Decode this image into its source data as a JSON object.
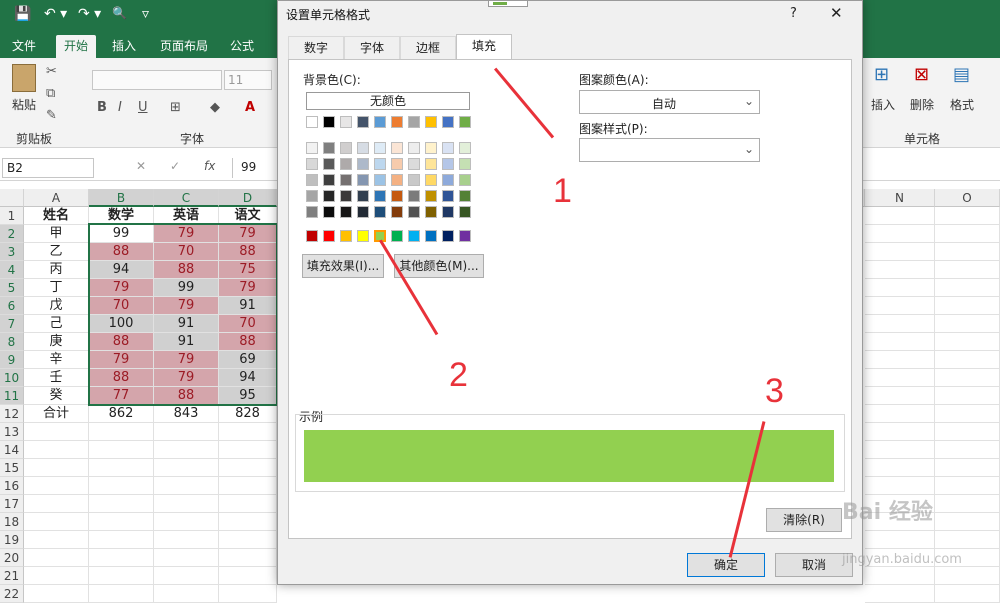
{
  "quick_access": {
    "save_icon": "💾",
    "undo": "↶ ▾",
    "redo": "↷ ▾",
    "preview": "🔍",
    "more": "▿"
  },
  "ribbon_tabs": [
    "文件",
    "开始",
    "插入",
    "页面布局",
    "公式"
  ],
  "ribbon": {
    "paste_label": "粘贴",
    "clipboard_label": "剪贴板",
    "font_label": "字体",
    "font_size": "11",
    "bold": "B",
    "italic": "I",
    "underline": "U",
    "insert_label": "插入",
    "delete_label": "删除",
    "format_label": "格式",
    "cells_label": "单元格"
  },
  "formula_bar": {
    "name_box": "B2",
    "cancel": "✕",
    "confirm": "✓",
    "fx": "fx",
    "value": "99"
  },
  "grid": {
    "columns": [
      "A",
      "B",
      "C",
      "D",
      "N",
      "O"
    ],
    "rows": [
      "1",
      "2",
      "3",
      "4",
      "5",
      "6",
      "7",
      "8",
      "9",
      "10",
      "11",
      "12",
      "13",
      "14",
      "15",
      "16",
      "17",
      "18",
      "19",
      "20",
      "21",
      "22"
    ],
    "table": [
      [
        "姓名",
        "数学",
        "英语",
        "语文"
      ],
      [
        "甲",
        "99",
        "79",
        "79"
      ],
      [
        "乙",
        "88",
        "70",
        "88"
      ],
      [
        "丙",
        "94",
        "88",
        "75"
      ],
      [
        "丁",
        "79",
        "99",
        "79"
      ],
      [
        "戊",
        "70",
        "79",
        "91"
      ],
      [
        "己",
        "100",
        "91",
        "70"
      ],
      [
        "庚",
        "88",
        "91",
        "88"
      ],
      [
        "辛",
        "79",
        "79",
        "69"
      ],
      [
        "壬",
        "88",
        "79",
        "94"
      ],
      [
        "癸",
        "77",
        "88",
        "95"
      ],
      [
        "合计",
        "862",
        "843",
        "828"
      ]
    ]
  },
  "dialog": {
    "title": "设置单元格格式",
    "help": "?",
    "close": "✕",
    "tabs": [
      "数字",
      "字体",
      "边框",
      "填充"
    ],
    "background_label": "背景色(C):",
    "no_color": "无颜色",
    "pattern_color_label": "图案颜色(A):",
    "pattern_color_value": "自动",
    "pattern_style_label": "图案样式(P):",
    "fill_effects": "填充效果(I)...",
    "more_colors": "其他颜色(M)...",
    "sample_label": "示例",
    "sample_color": "#92d050",
    "clear": "清除(R)",
    "ok": "确定",
    "cancel": "取消"
  },
  "palette": {
    "row1": [
      "#ffffff",
      "#000000",
      "#e7e6e6",
      "#44546a",
      "#5b9bd5",
      "#ed7d31",
      "#a5a5a5",
      "#ffc000",
      "#4472c4",
      "#70ad47"
    ],
    "tints": [
      [
        "#f2f2f2",
        "#7f7f7f",
        "#d0cece",
        "#d6dce4",
        "#deebf6",
        "#fbe5d5",
        "#ededed",
        "#fff2cc",
        "#d9e2f3",
        "#e2efd9"
      ],
      [
        "#d8d8d8",
        "#595959",
        "#aeaaaa",
        "#adb9ca",
        "#bdd7ee",
        "#f7cbac",
        "#dbdbdb",
        "#fee599",
        "#b4c6e7",
        "#c5e0b3"
      ],
      [
        "#bfbfbf",
        "#3f3f3f",
        "#757070",
        "#8496b0",
        "#9cc3e5",
        "#f4b183",
        "#c9c9c9",
        "#ffd965",
        "#8eaadb",
        "#a8d08d"
      ],
      [
        "#a5a5a5",
        "#262626",
        "#3a3838",
        "#323f4f",
        "#2e75b5",
        "#c55a11",
        "#7b7b7b",
        "#bf9000",
        "#2f5496",
        "#538135"
      ],
      [
        "#7f7f7f",
        "#0c0c0c",
        "#171616",
        "#222a35",
        "#1e4e79",
        "#833c0b",
        "#525252",
        "#7f6000",
        "#1f3864",
        "#375623"
      ]
    ],
    "standard": [
      "#c00000",
      "#ff0000",
      "#ffc000",
      "#ffff00",
      "#92d050",
      "#00b050",
      "#00b0f0",
      "#0070c0",
      "#002060",
      "#7030a0"
    ]
  },
  "annotations": [
    "1",
    "2",
    "3"
  ],
  "watermark": {
    "brand": "Bai 经验",
    "url": "jingyan.baidu.com"
  }
}
